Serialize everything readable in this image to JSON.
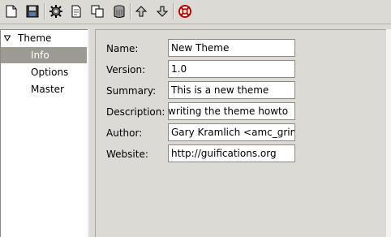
{
  "toolbar": {
    "buttons": [
      {
        "name": "new-document-icon"
      },
      {
        "name": "save-icon"
      },
      {
        "name": "preferences-gear-icon"
      },
      {
        "name": "import-icon"
      },
      {
        "name": "copy-icon"
      },
      {
        "name": "delete-icon"
      },
      {
        "name": "move-up-icon"
      },
      {
        "name": "move-down-icon"
      },
      {
        "name": "help-lifebuoy-icon"
      }
    ]
  },
  "tree": {
    "root": "Theme",
    "items": [
      "Info",
      "Options",
      "Master"
    ],
    "selected": "Info"
  },
  "form": {
    "name_label": "Name:",
    "name_value": "New Theme",
    "version_label": "Version:",
    "version_value": "1.0",
    "summary_label": "Summary:",
    "summary_value": "This is a new theme",
    "description_label": "Description:",
    "description_value": "writing the theme howto",
    "author_label": "Author:",
    "author_value": "Gary Kramlich <amc_grim",
    "website_label": "Website:",
    "website_value": "http://guifications.org"
  },
  "colors": {
    "window_bg": "#dcdad5",
    "selection_bg": "#9d9a93"
  }
}
